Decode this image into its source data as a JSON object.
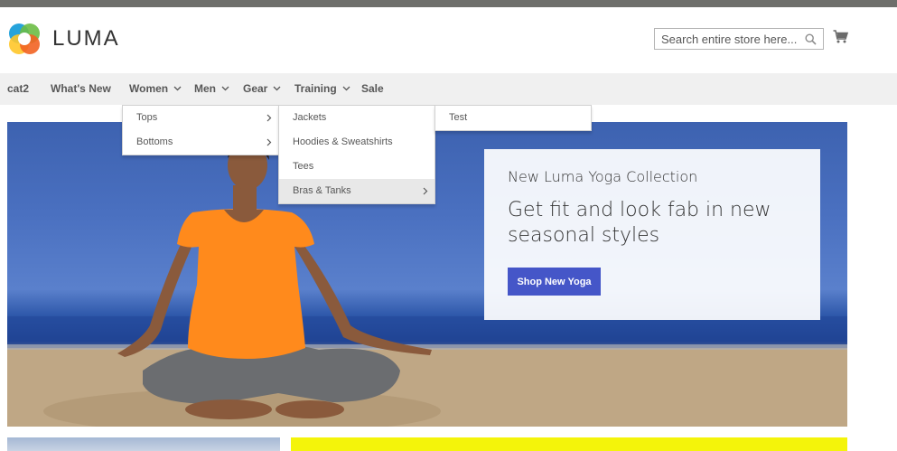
{
  "brand": {
    "name": "LUMA",
    "logo_colors": [
      "#f26322",
      "#ffc629",
      "#6cbd45",
      "#1a9ed9"
    ]
  },
  "search": {
    "placeholder": "Search entire store here...",
    "icon": "search-icon"
  },
  "cart": {
    "icon": "cart-icon"
  },
  "nav": {
    "items": [
      {
        "label": "cat2",
        "has_submenu": false
      },
      {
        "label": "What's New",
        "has_submenu": false
      },
      {
        "label": "Women",
        "has_submenu": true
      },
      {
        "label": "Men",
        "has_submenu": true
      },
      {
        "label": "Gear",
        "has_submenu": true
      },
      {
        "label": "Training",
        "has_submenu": true
      },
      {
        "label": "Sale",
        "has_submenu": false
      }
    ]
  },
  "menu_level1": [
    {
      "label": "Tops",
      "has_submenu": true
    },
    {
      "label": "Bottoms",
      "has_submenu": true
    }
  ],
  "menu_level2": [
    {
      "label": "Jackets",
      "has_submenu": false
    },
    {
      "label": "Hoodies & Sweatshirts",
      "has_submenu": false
    },
    {
      "label": "Tees",
      "has_submenu": false
    },
    {
      "label": "Bras & Tanks",
      "has_submenu": true,
      "active": true
    }
  ],
  "menu_level3": [
    {
      "label": "Test",
      "has_submenu": false
    }
  ],
  "promo": {
    "eyebrow": "New Luma Yoga Collection",
    "title": "Get fit and look fab in new seasonal styles",
    "button_label": "Shop New Yoga",
    "button_color": "#4556c8"
  },
  "colors": {
    "nav_bg": "#f0f0f0",
    "topbar": "#6e6f6b",
    "tile_yellow": "#f4f40a"
  }
}
